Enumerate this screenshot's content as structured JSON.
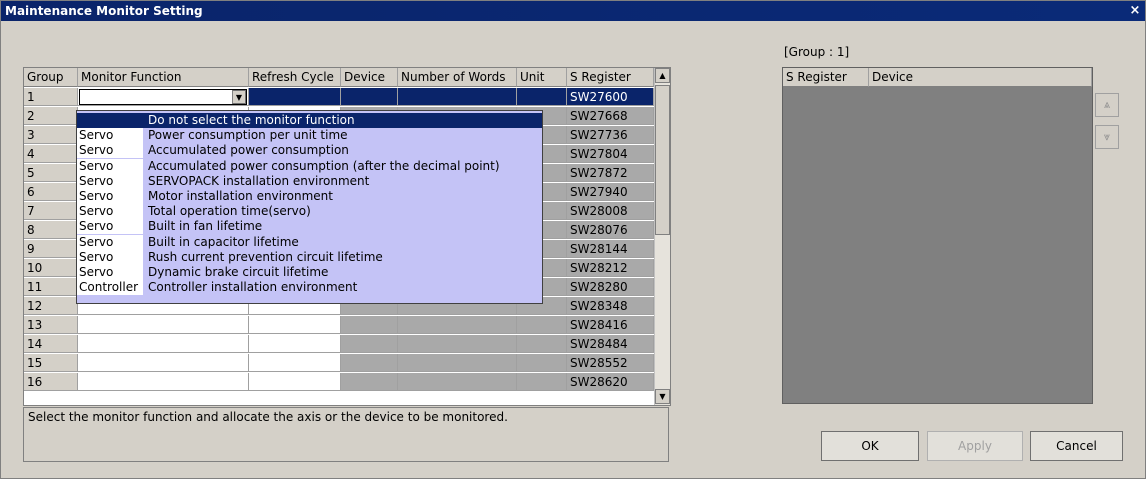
{
  "window": {
    "title": "Maintenance Monitor Setting",
    "close_glyph": "×"
  },
  "grid": {
    "headers": [
      "Group",
      "Monitor Function",
      "Refresh Cycle",
      "Device",
      "Number of Words",
      "Unit",
      "S Register"
    ],
    "rows": [
      {
        "group": "1",
        "sreg": "SW27600"
      },
      {
        "group": "2",
        "sreg": "SW27668"
      },
      {
        "group": "3",
        "sreg": "SW27736"
      },
      {
        "group": "4",
        "sreg": "SW27804"
      },
      {
        "group": "5",
        "sreg": "SW27872"
      },
      {
        "group": "6",
        "sreg": "SW27940"
      },
      {
        "group": "7",
        "sreg": "SW28008"
      },
      {
        "group": "8",
        "sreg": "SW28076"
      },
      {
        "group": "9",
        "sreg": "SW28144"
      },
      {
        "group": "10",
        "sreg": "SW28212"
      },
      {
        "group": "11",
        "sreg": "SW28280"
      },
      {
        "group": "12",
        "sreg": "SW28348"
      },
      {
        "group": "13",
        "sreg": "SW28416"
      },
      {
        "group": "14",
        "sreg": "SW28484"
      },
      {
        "group": "15",
        "sreg": "SW28552"
      },
      {
        "group": "16",
        "sreg": "SW28620"
      }
    ]
  },
  "dropdown": {
    "items": [
      {
        "category": "",
        "label": "Do not select the monitor function"
      },
      {
        "category": "Servo",
        "label": "Power consumption per unit time"
      },
      {
        "category": "Servo",
        "label": "Accumulated power consumption"
      },
      {
        "category": "Servo",
        "label": "Accumulated power consumption (after the decimal point)"
      },
      {
        "category": "Servo",
        "label": "SERVOPACK installation environment"
      },
      {
        "category": "Servo",
        "label": "Motor installation environment"
      },
      {
        "category": "Servo",
        "label": "Total operation time(servo)"
      },
      {
        "category": "Servo",
        "label": "Built in fan lifetime"
      },
      {
        "category": "Servo",
        "label": "Built in capacitor lifetime"
      },
      {
        "category": "Servo",
        "label": "Rush current prevention circuit lifetime"
      },
      {
        "category": "Servo",
        "label": "Dynamic brake circuit lifetime"
      },
      {
        "category": "Controller",
        "label": "Controller installation environment"
      }
    ]
  },
  "description": "Select the monitor function and allocate the axis or the device to be monitored.",
  "right_panel": {
    "group_label": "[Group : 1]",
    "headers": [
      "S Register",
      "Device"
    ]
  },
  "buttons": {
    "ok": "OK",
    "apply": "Apply",
    "cancel": "Cancel"
  },
  "icons": {
    "combo_arrow": "▼",
    "scroll_up": "▲",
    "scroll_down": "▼",
    "move_up": "⩓",
    "move_down": "⩔"
  }
}
